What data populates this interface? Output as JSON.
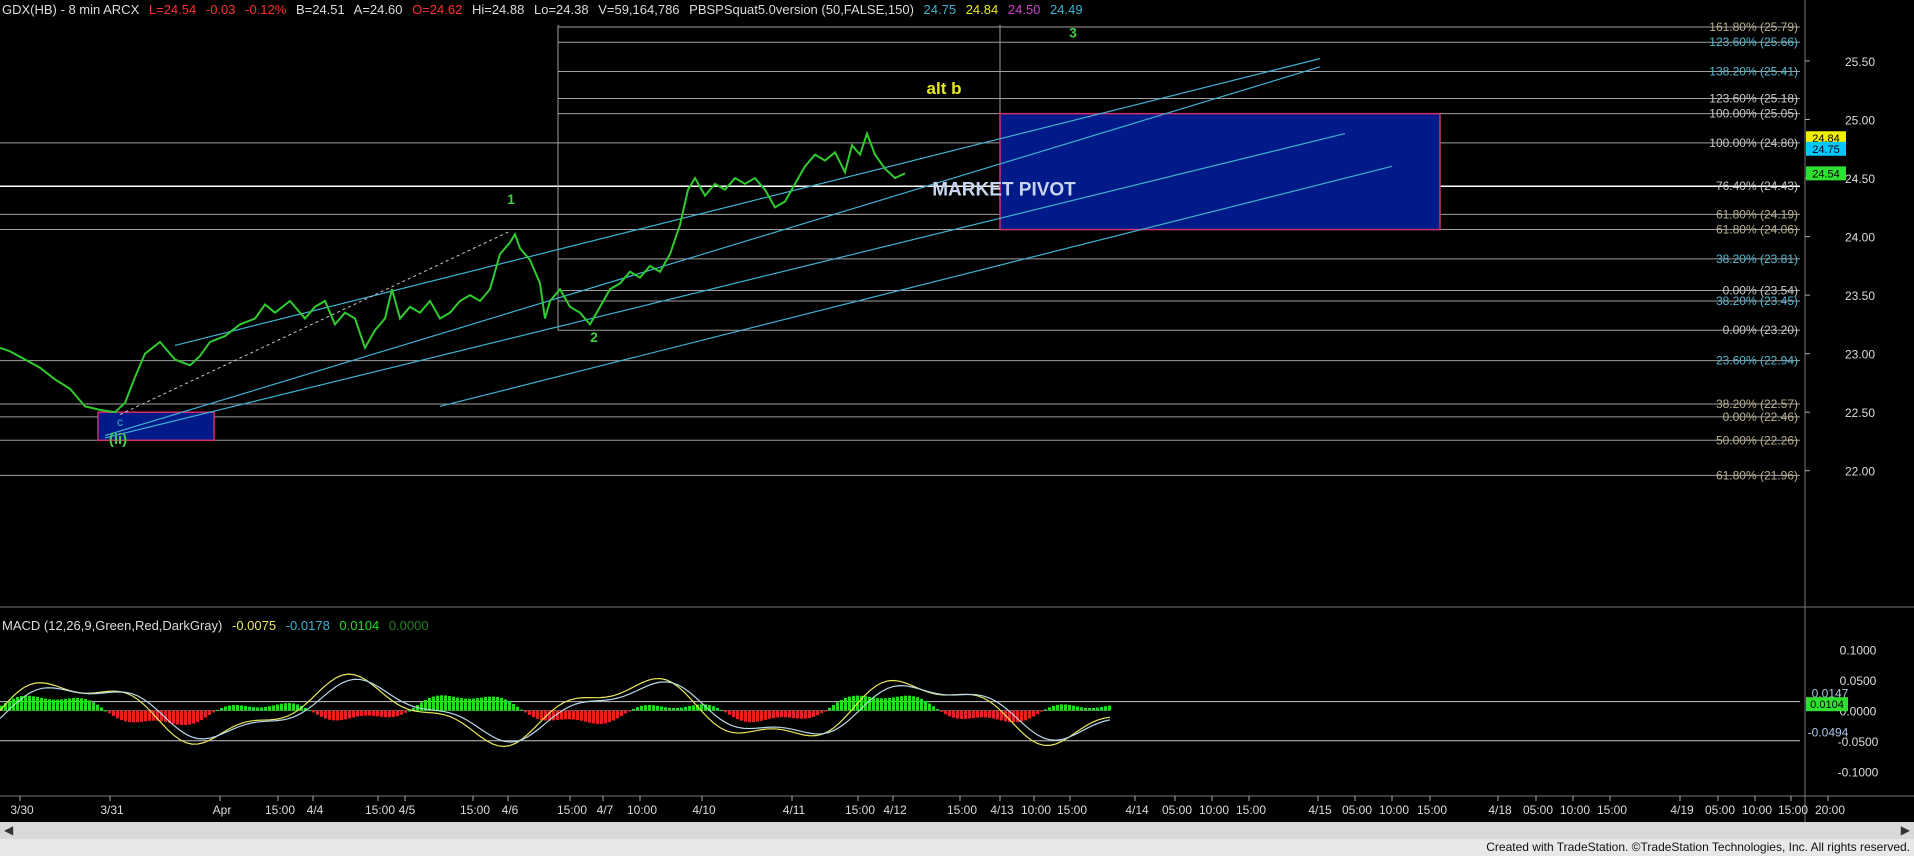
{
  "header": {
    "symbol": "GDX(HB) - 8 min  ARCX",
    "last": "L=24.54",
    "chg": "-0.03",
    "pct": "-0.12%",
    "bid": "B=24.51",
    "ask": "A=24.60",
    "open": "O=24.62",
    "hi": "Hi=24.88",
    "lo": "Lo=24.38",
    "vol": "V=59,164,786",
    "study": "PBSPSquat5.0version (50,FALSE,150)",
    "v1": "24.75",
    "v2": "24.84",
    "v3": "24.50",
    "v4": "24.49"
  },
  "macd_header": {
    "label": "MACD (12,26,9,Green,Red,DarkGray)",
    "v1": "-0.0075",
    "v2": "-0.0178",
    "v3": "0.0104",
    "v4": "0.0000"
  },
  "footer": "Created with TradeStation. ©TradeStation Technologies, Inc. All rights reserved.",
  "colors": {
    "price": "#2fcb2f",
    "channel": "#3fb0d0",
    "box_fill": "#001a8a",
    "box_border": "#d0306a",
    "fib_line": "#c8c8c8",
    "macd_pos": "#22dd22",
    "macd_neg": "#e82020",
    "label_yellow": "#e8e820",
    "label_green": "#44cc44"
  },
  "chart_data": [
    {
      "type": "line",
      "panel": "price",
      "ylim": [
        21.75,
        25.85
      ],
      "y_ticks": [
        "25.50",
        "25.00",
        "24.50",
        "24.00",
        "23.50",
        "23.00",
        "22.50",
        "22.00"
      ],
      "x_tick_labels": [
        "3/30",
        "3/31",
        "Apr",
        "15:00",
        "4/4",
        "15:00",
        "4/5",
        "15:00",
        "4/6",
        "15:00",
        "4/7",
        "10:00",
        "4/10",
        "4/11",
        "15:00",
        "4/12",
        "15:00",
        "4/13",
        "10:00",
        "15:00",
        "4/14",
        "05:00",
        "10:00",
        "15:00",
        "4/15",
        "05:00",
        "10:00",
        "15:00",
        "4/18",
        "05:00",
        "10:00",
        "15:00",
        "4/19",
        "05:00",
        "10:00",
        "15:00",
        "20:00"
      ],
      "price_series": [
        [
          0,
          23.05
        ],
        [
          10,
          23.02
        ],
        [
          25,
          22.95
        ],
        [
          40,
          22.88
        ],
        [
          55,
          22.78
        ],
        [
          70,
          22.7
        ],
        [
          85,
          22.55
        ],
        [
          100,
          22.52
        ],
        [
          115,
          22.5
        ],
        [
          125,
          22.58
        ],
        [
          135,
          22.8
        ],
        [
          145,
          23.0
        ],
        [
          160,
          23.1
        ],
        [
          175,
          22.95
        ],
        [
          190,
          22.9
        ],
        [
          200,
          22.98
        ],
        [
          210,
          23.1
        ],
        [
          225,
          23.15
        ],
        [
          240,
          23.25
        ],
        [
          255,
          23.3
        ],
        [
          265,
          23.42
        ],
        [
          275,
          23.35
        ],
        [
          290,
          23.45
        ],
        [
          305,
          23.3
        ],
        [
          315,
          23.4
        ],
        [
          325,
          23.45
        ],
        [
          335,
          23.25
        ],
        [
          345,
          23.35
        ],
        [
          355,
          23.3
        ],
        [
          365,
          23.05
        ],
        [
          375,
          23.2
        ],
        [
          385,
          23.3
        ],
        [
          392,
          23.55
        ],
        [
          400,
          23.3
        ],
        [
          410,
          23.4
        ],
        [
          420,
          23.35
        ],
        [
          430,
          23.45
        ],
        [
          440,
          23.3
        ],
        [
          450,
          23.35
        ],
        [
          460,
          23.45
        ],
        [
          470,
          23.5
        ],
        [
          480,
          23.45
        ],
        [
          490,
          23.55
        ],
        [
          500,
          23.85
        ],
        [
          510,
          23.95
        ],
        [
          515,
          24.02
        ],
        [
          520,
          23.9
        ],
        [
          530,
          23.8
        ],
        [
          540,
          23.6
        ],
        [
          545,
          23.3
        ],
        [
          550,
          23.45
        ],
        [
          560,
          23.55
        ],
        [
          570,
          23.4
        ],
        [
          580,
          23.35
        ],
        [
          590,
          23.25
        ],
        [
          600,
          23.4
        ],
        [
          610,
          23.55
        ],
        [
          620,
          23.6
        ],
        [
          630,
          23.7
        ],
        [
          640,
          23.65
        ],
        [
          650,
          23.75
        ],
        [
          660,
          23.7
        ],
        [
          670,
          23.85
        ],
        [
          680,
          24.1
        ],
        [
          688,
          24.4
        ],
        [
          695,
          24.5
        ],
        [
          705,
          24.35
        ],
        [
          715,
          24.45
        ],
        [
          725,
          24.4
        ],
        [
          735,
          24.5
        ],
        [
          745,
          24.45
        ],
        [
          755,
          24.5
        ],
        [
          765,
          24.4
        ],
        [
          775,
          24.25
        ],
        [
          785,
          24.3
        ],
        [
          795,
          24.45
        ],
        [
          805,
          24.6
        ],
        [
          815,
          24.7
        ],
        [
          825,
          24.65
        ],
        [
          835,
          24.72
        ],
        [
          845,
          24.55
        ],
        [
          852,
          24.78
        ],
        [
          860,
          24.7
        ],
        [
          867,
          24.88
        ],
        [
          875,
          24.7
        ],
        [
          885,
          24.58
        ],
        [
          895,
          24.5
        ],
        [
          905,
          24.54
        ]
      ],
      "price_series_x_units": "bar index",
      "fib_levels": [
        {
          "label": "161.80% (25.79)",
          "value": 25.79
        },
        {
          "label": "123.60% (25.66)",
          "value": 25.66
        },
        {
          "label": "138.20% (25.41)",
          "value": 25.41
        },
        {
          "label": "123.60% (25.18)",
          "value": 25.18
        },
        {
          "label": "100.00% (25.05)",
          "value": 25.05
        },
        {
          "label": "100.00% (24.80)",
          "value": 24.8
        },
        {
          "label": "76.40% (24.43)",
          "value": 24.43
        },
        {
          "label": "61.80% (24.19)",
          "value": 24.19
        },
        {
          "label": "61.80% (24.06)",
          "value": 24.06
        },
        {
          "label": "38.20% (23.81)",
          "value": 23.81
        },
        {
          "label": "0.00% (23.54)",
          "value": 23.54
        },
        {
          "label": "38.20% (23.45)",
          "value": 23.45
        },
        {
          "label": "0.00% (23.20)",
          "value": 23.2
        },
        {
          "label": "23.60% (22.94)",
          "value": 22.94
        },
        {
          "label": "38.20% (22.57)",
          "value": 22.57
        },
        {
          "label": "0.00% (22.46)",
          "value": 22.46
        },
        {
          "label": "50.00% (22.26)",
          "value": 22.26
        },
        {
          "label": "61.80% (21.96)",
          "value": 21.96
        }
      ],
      "price_tags": [
        "24.84",
        "24.75",
        "24.54"
      ],
      "annotations": [
        {
          "text": "3",
          "x": 1073,
          "y": 25.7
        },
        {
          "text": "alt b",
          "x": 944,
          "y": 25.22
        },
        {
          "text": "1",
          "x": 511,
          "y": 24.28
        },
        {
          "text": "2",
          "x": 594,
          "y": 23.1
        },
        {
          "text": "(ii)",
          "x": 118,
          "y": 22.23
        },
        {
          "text": "c",
          "x": 120,
          "y": 22.38
        },
        {
          "text": "MARKET PIVOT",
          "x": 1004,
          "y": 24.35
        }
      ]
    },
    {
      "type": "line",
      "panel": "macd",
      "ylim": [
        -0.13,
        0.14
      ],
      "y_ticks": [
        "0.1000",
        "0.0500",
        "0.0000",
        "-0.0500",
        "-0.1000"
      ],
      "ref_levels": [
        "0.0147",
        "-0.0494"
      ],
      "value_tag": "0.0104"
    }
  ]
}
